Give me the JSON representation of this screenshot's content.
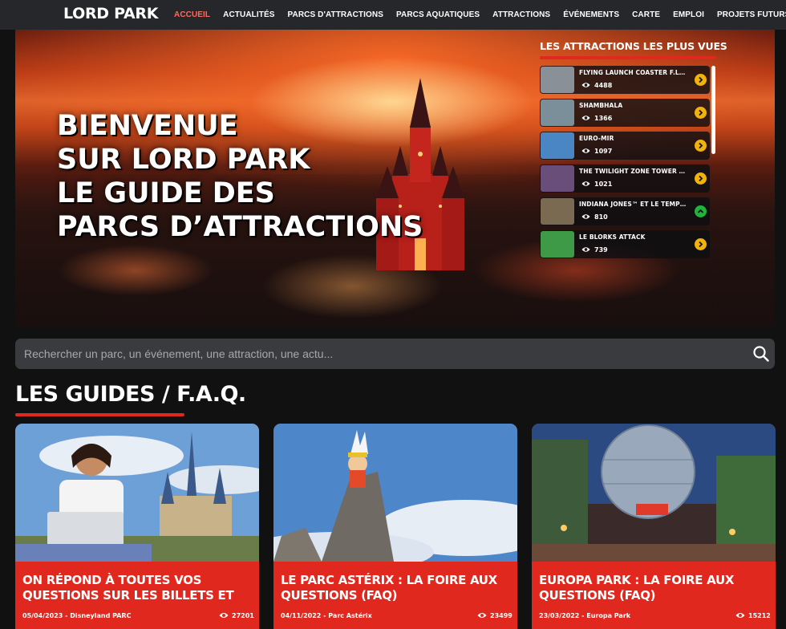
{
  "nav": {
    "logo": "LORD PARK",
    "items": [
      "ACCUEIL",
      "ACTUALITÉS",
      "PARCS D'ATTRACTIONS",
      "PARCS AQUATIQUES",
      "ATTRACTIONS",
      "ÉVÉNEMENTS",
      "CARTE",
      "EMPLOI",
      "PROJETS FUTURS"
    ],
    "active": "ACCUEIL"
  },
  "hero": {
    "title_lines": [
      "BIENVENUE",
      "SUR LORD PARK",
      "LE GUIDE DES",
      "PARCS D’ATTRACTIONS"
    ]
  },
  "most_viewed": {
    "title": "LES ATTRACTIONS LES PLUS VUES",
    "items": [
      {
        "name": "FLYING LAUNCH COASTER F.L.Y.",
        "views": "4488",
        "arrow": "right",
        "thumb": "#8a9098"
      },
      {
        "name": "SHAMBHALA",
        "views": "1366",
        "arrow": "right",
        "thumb": "#7a8f9a"
      },
      {
        "name": "EURO-MIR",
        "views": "1097",
        "arrow": "right",
        "thumb": "#4a86c4"
      },
      {
        "name": "THE TWILIGHT ZONE TOWER OF ...",
        "views": "1021",
        "arrow": "right",
        "thumb": "#6a4e7a"
      },
      {
        "name": "INDIANA JONES™ ET LE TEMPLE ...",
        "views": "810",
        "arrow": "up",
        "thumb": "#7a6a52"
      },
      {
        "name": "LE BLORKS ATTACK",
        "views": "739",
        "arrow": "right",
        "thumb": "#3f9a48"
      }
    ]
  },
  "search": {
    "placeholder": "Rechercher un parc, un événement, une attraction, une actu..."
  },
  "guides": {
    "title": "LES GUIDES / F.A.Q.",
    "cards": [
      {
        "title": "ON RÉPOND À TOUTES VOS QUESTIONS SUR LES BILLETS ET LES",
        "meta": "05/04/2023 - Disneyland PARC",
        "views": "27201"
      },
      {
        "title": "LE PARC ASTÉRIX : LA FOIRE AUX QUESTIONS (FAQ)",
        "meta": "04/11/2022 - Parc Astérix",
        "views": "23499"
      },
      {
        "title": "EUROPA PARK : LA FOIRE AUX QUESTIONS (FAQ)",
        "meta": "23/03/2022 - Europa Park",
        "views": "15212"
      }
    ]
  },
  "colors": {
    "accent": "#e0281f",
    "nav_bg": "#26272b",
    "active_nav": "#ff6a5c",
    "page_bg": "#111112"
  }
}
